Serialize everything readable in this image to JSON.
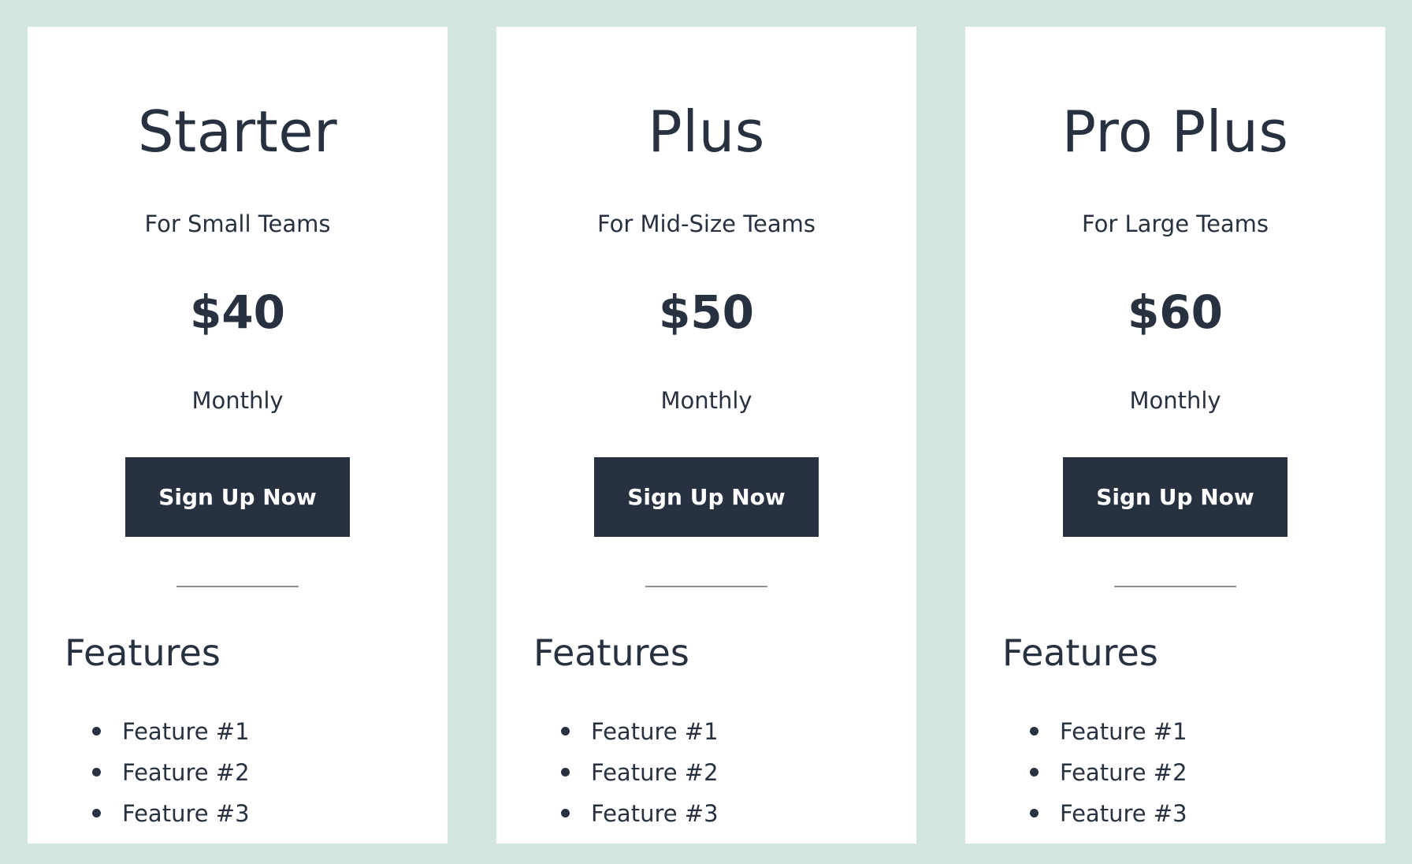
{
  "plans": [
    {
      "name": "Starter",
      "subtitle": "For Small Teams",
      "price": "$40",
      "period": "Monthly",
      "cta_label": "Sign Up Now",
      "features_heading": "Features",
      "features": [
        "Feature #1",
        "Feature #2",
        "Feature #3"
      ]
    },
    {
      "name": "Plus",
      "subtitle": "For Mid-Size Teams",
      "price": "$50",
      "period": "Monthly",
      "cta_label": "Sign Up Now",
      "features_heading": "Features",
      "features": [
        "Feature #1",
        "Feature #2",
        "Feature #3"
      ]
    },
    {
      "name": "Pro Plus",
      "subtitle": "For Large Teams",
      "price": "$60",
      "period": "Monthly",
      "cta_label": "Sign Up Now",
      "features_heading": "Features",
      "features": [
        "Feature #1",
        "Feature #2",
        "Feature #3"
      ]
    }
  ],
  "colors": {
    "page_background": "#d2e5df",
    "card_background": "#ffffff",
    "text": "#283140",
    "button_background": "#283140",
    "button_text": "#ffffff",
    "divider": "#8a9099"
  }
}
